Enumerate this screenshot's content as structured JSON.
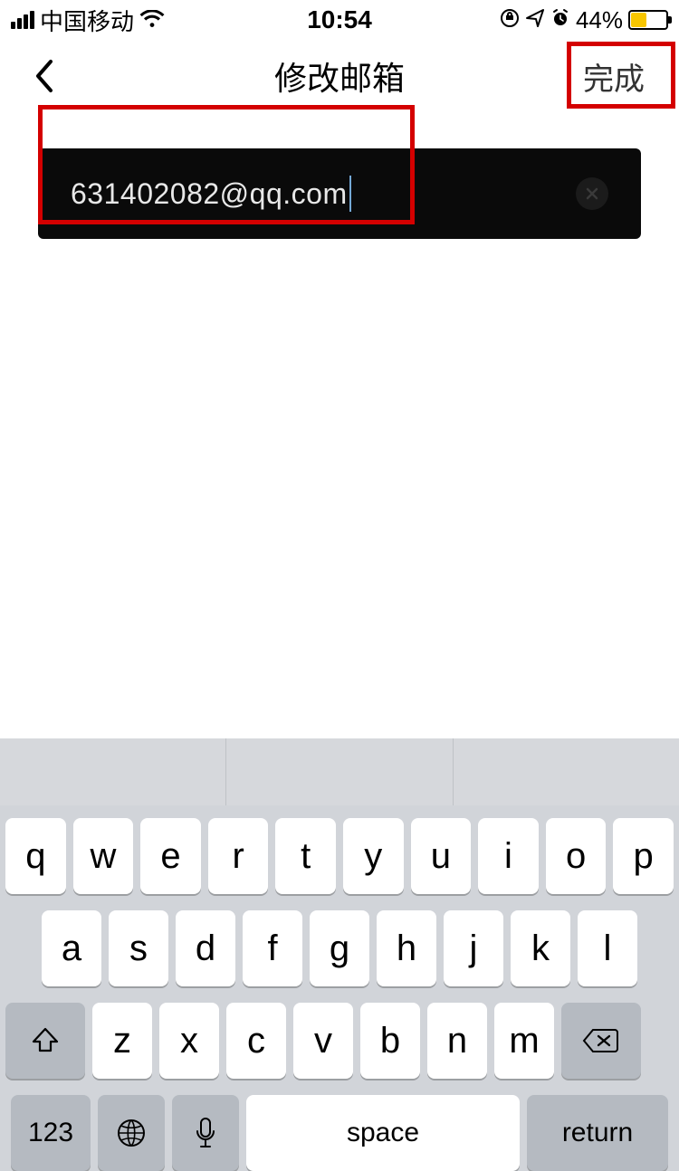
{
  "status": {
    "carrier": "中国移动",
    "time": "10:54",
    "battery_pct": "44%"
  },
  "nav": {
    "title": "修改邮箱",
    "done": "完成"
  },
  "form": {
    "email_value": "631402082@qq.com"
  },
  "keyboard": {
    "row1": [
      "q",
      "w",
      "e",
      "r",
      "t",
      "y",
      "u",
      "i",
      "o",
      "p"
    ],
    "row2": [
      "a",
      "s",
      "d",
      "f",
      "g",
      "h",
      "j",
      "k",
      "l"
    ],
    "row3": [
      "z",
      "x",
      "c",
      "v",
      "b",
      "n",
      "m"
    ],
    "sym": "123",
    "space": "space",
    "return": "return"
  }
}
